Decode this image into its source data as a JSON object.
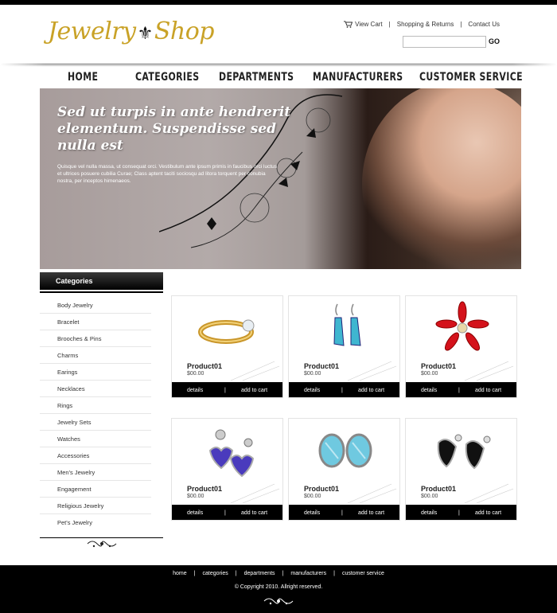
{
  "header": {
    "logo_part1": "Jewelry",
    "logo_fleur": "⚜",
    "logo_part2": "Shop",
    "links": {
      "view_cart": "View Cart",
      "shipping": "Shopping & Returns",
      "contact": "Contact Us",
      "sep": "|"
    },
    "search": {
      "placeholder": "",
      "go_label": "GO"
    }
  },
  "nav": [
    "HOME",
    "CATEGORIES",
    "DEPARTMENTS",
    "MANUFACTURERS",
    "CUSTOMER SERVICE"
  ],
  "banner": {
    "title": "Sed ut turpis in ante hendrerit elementum. Suspendisse sed nulla est",
    "text": "Quisque vel nulla massa, ut consequat orci. Vestibulum ante ipsum primis in faucibus orci luctus et ultrices posuere cubilia Curae; Class aptent taciti sociosqu ad litora torquent per conubia nostra, per inceptos himenaeos."
  },
  "sidebar": {
    "title": "Categories",
    "items": [
      "Body Jewelry",
      "Bracelet",
      "Brooches & Pins",
      "Charms",
      "Earings",
      "Necklaces",
      "Rings",
      "Jewelry Sets",
      "Watches",
      "Accessories",
      "Men's Jewelry",
      "Engagement",
      "Religious Jewelry",
      "Pet's Jewelry"
    ]
  },
  "products": [
    {
      "name": "Product01",
      "price": "$00.00",
      "details": "details",
      "sep": "|",
      "add": "add to cart",
      "icon": "gold-ring-icon"
    },
    {
      "name": "Product01",
      "price": "$00.00",
      "details": "details",
      "sep": "|",
      "add": "add to cart",
      "icon": "blue-earrings-icon"
    },
    {
      "name": "Product01",
      "price": "$00.00",
      "details": "details",
      "sep": "|",
      "add": "add to cart",
      "icon": "red-flower-brooch-icon"
    },
    {
      "name": "Product01",
      "price": "$00.00",
      "details": "details",
      "sep": "|",
      "add": "add to cart",
      "icon": "purple-heart-earrings-icon"
    },
    {
      "name": "Product01",
      "price": "$00.00",
      "details": "details",
      "sep": "|",
      "add": "add to cart",
      "icon": "aqua-earrings-icon"
    },
    {
      "name": "Product01",
      "price": "$00.00",
      "details": "details",
      "sep": "|",
      "add": "add to cart",
      "icon": "black-gem-earrings-icon"
    }
  ],
  "footer": {
    "links": [
      "home",
      "categories",
      "departments",
      "manufacturers",
      "customer service"
    ],
    "sep": "|",
    "copyright": "© Copyright 2010. Allright reserved."
  },
  "colors": {
    "logo_gold": "#c9a227",
    "bar_black": "#000000"
  }
}
